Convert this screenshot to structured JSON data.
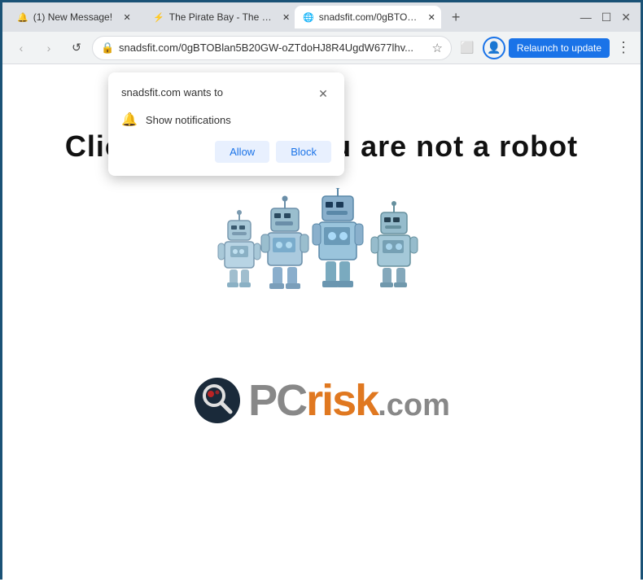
{
  "titleBar": {
    "tabs": [
      {
        "id": "tab1",
        "label": "(1) New Message!",
        "active": false,
        "icon": "notification"
      },
      {
        "id": "tab2",
        "label": "The Pirate Bay - The …",
        "active": false,
        "icon": "piratebay"
      },
      {
        "id": "tab3",
        "label": "snadsfit.com/0gBTO…",
        "active": true,
        "icon": "snadsfit"
      }
    ],
    "addTabLabel": "+",
    "minimize": "—",
    "maximize": "☐",
    "close": "✕"
  },
  "navBar": {
    "back": "‹",
    "forward": "›",
    "reload": "↺",
    "addressBar": {
      "icon": "🔒",
      "url": "snadsfit.com/0gBTOBlan5B20GW-oZTdoHJ8R4UgdW677lhv...",
      "star": "☆"
    },
    "profile": "👤",
    "relaunchButton": "Relaunch to update",
    "menu": "⋮",
    "extensions": "⬜"
  },
  "popup": {
    "title": "snadsfit.com wants to",
    "close": "✕",
    "notification": {
      "icon": "🔔",
      "text": "Show notifications"
    },
    "allowButton": "Allow",
    "blockButton": "Block"
  },
  "pageContent": {
    "captchaText": "Click \"Allow\"   if you are not   a robot"
  },
  "logo": {
    "pc": "PC",
    "risk": "risk",
    "dotCom": ".com"
  }
}
